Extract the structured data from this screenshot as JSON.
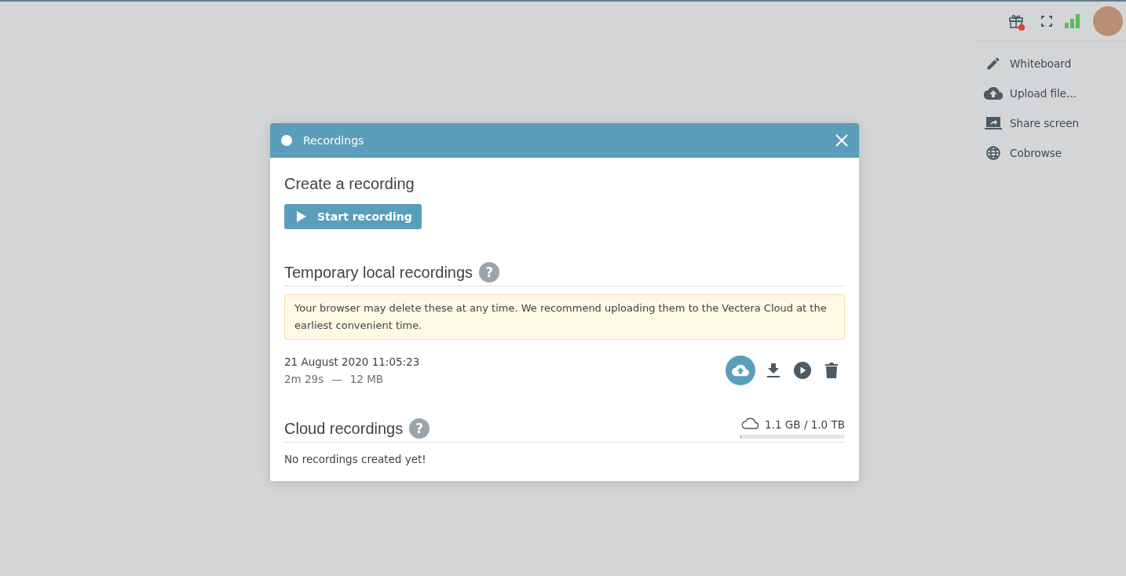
{
  "toolbar": {
    "notification": true
  },
  "menu": [
    {
      "kind": "pencil",
      "label": "Whiteboard"
    },
    {
      "kind": "upload",
      "label": "Upload file..."
    },
    {
      "kind": "screen",
      "label": "Share screen"
    },
    {
      "kind": "globe",
      "label": "Cobrowse"
    }
  ],
  "dialog": {
    "title": "Recordings",
    "create": {
      "heading": "Create a recording",
      "button": "Start recording"
    },
    "local": {
      "heading": "Temporary local recordings",
      "help": "?",
      "notice": "Your browser may delete these at any time. We recommend uploading them to the Vectera Cloud at the earliest convenient time.",
      "items": [
        {
          "date": "21 August 2020 11:05:23",
          "duration": "2m 29s",
          "separator": "—",
          "size": "12 MB"
        }
      ]
    },
    "cloud": {
      "heading": "Cloud recordings",
      "help": "?",
      "usage": "1.1 GB / 1.0 TB",
      "level": 0.0011,
      "empty": "No recordings created yet!"
    }
  }
}
